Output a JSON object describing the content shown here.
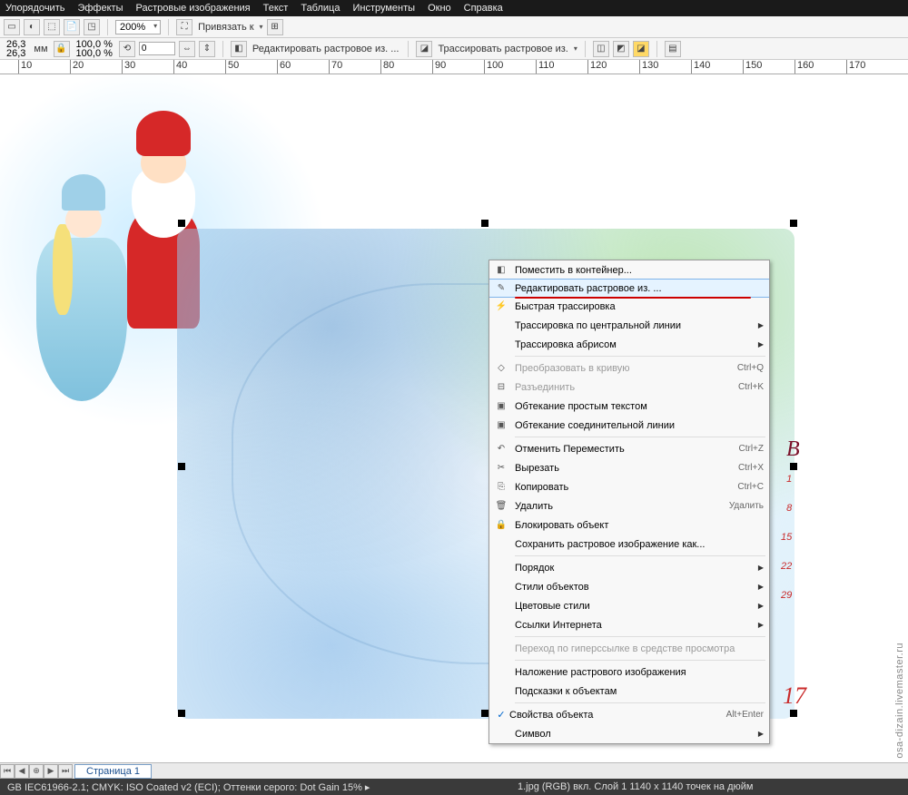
{
  "menubar": [
    "Упорядочить",
    "Эффекты",
    "Растровые изображения",
    "Текст",
    "Таблица",
    "Инструменты",
    "Окно",
    "Справка"
  ],
  "toolbar1": {
    "zoom": "200%",
    "snap_label": "Привязать к"
  },
  "toolbar2": {
    "coord_x": "26,3",
    "coord_y": "26,3",
    "size_label": "мм",
    "deg": "0",
    "btn1": "Редактировать растровое из. ...",
    "btn2": "Трассировать растровое из."
  },
  "ruler_ticks": [
    "10",
    "20",
    "30",
    "40",
    "50",
    "60",
    "70",
    "80",
    "90",
    "100",
    "110",
    "120",
    "130",
    "140",
    "150",
    "160",
    "170"
  ],
  "context_menu": [
    {
      "icon": "◧",
      "label": "Поместить в контейнер...",
      "type": "item"
    },
    {
      "icon": "✎",
      "label": "Редактировать растровое из. ...",
      "type": "item",
      "highlight": true
    },
    {
      "icon": "⚡",
      "label": "Быстрая трассировка",
      "type": "item"
    },
    {
      "label": "Трассировка по центральной линии",
      "type": "submenu"
    },
    {
      "label": "Трассировка абрисом",
      "type": "submenu"
    },
    {
      "type": "sep"
    },
    {
      "icon": "◇",
      "label": "Преобразовать в кривую",
      "shortcut": "Ctrl+Q",
      "type": "item",
      "disabled": true
    },
    {
      "icon": "⊟",
      "label": "Разъединить",
      "shortcut": "Ctrl+K",
      "type": "item",
      "disabled": true
    },
    {
      "icon": "▣",
      "label": "Обтекание простым текстом",
      "type": "item"
    },
    {
      "icon": "▣",
      "label": "Обтекание соединительной линии",
      "type": "item"
    },
    {
      "type": "sep"
    },
    {
      "icon": "↶",
      "label": "Отменить Переместить",
      "shortcut": "Ctrl+Z",
      "type": "item"
    },
    {
      "icon": "✂",
      "label": "Вырезать",
      "shortcut": "Ctrl+X",
      "type": "item"
    },
    {
      "icon": "⎘",
      "label": "Копировать",
      "shortcut": "Ctrl+C",
      "type": "item"
    },
    {
      "icon": "🗑",
      "label": "Удалить",
      "shortcut": "Удалить",
      "type": "item"
    },
    {
      "icon": "🔒",
      "label": "Блокировать объект",
      "type": "item"
    },
    {
      "label": "Сохранить растровое изображение как...",
      "type": "item"
    },
    {
      "type": "sep"
    },
    {
      "label": "Порядок",
      "type": "submenu"
    },
    {
      "label": "Стили объектов",
      "type": "submenu"
    },
    {
      "label": "Цветовые стили",
      "type": "submenu"
    },
    {
      "label": "Ссылки Интернета",
      "type": "submenu"
    },
    {
      "type": "sep"
    },
    {
      "label": "Переход по гиперссылке в средстве просмотра",
      "type": "item",
      "disabled": true
    },
    {
      "type": "sep"
    },
    {
      "label": "Наложение растрового изображения",
      "type": "item"
    },
    {
      "label": "Подсказки к объектам",
      "type": "item"
    },
    {
      "type": "sep"
    },
    {
      "check": true,
      "label": "Свойства объекта",
      "shortcut": "Alt+Enter",
      "type": "item"
    },
    {
      "label": "Символ",
      "type": "submenu"
    }
  ],
  "page_tab": "Страница 1",
  "status": {
    "left": "GB IEC61966-2.1; CMYK: ISO Coated v2 (ECI); Оттенки серого: Dot Gain 15% ▸",
    "center": "1.jpg (RGB) вкл. Слой 1 1140 x 1140 точек на дюйм"
  },
  "watermark": "osa-dizain.livemaster.ru",
  "cal_nums": [
    "1",
    "8",
    "15",
    "22",
    "29"
  ],
  "cal_b": "В",
  "cal_year": "17"
}
